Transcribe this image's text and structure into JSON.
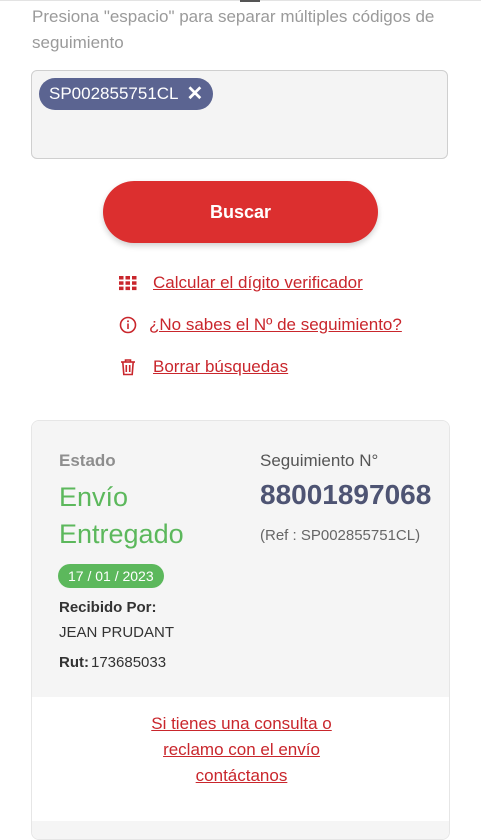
{
  "search": {
    "hint": "Presiona \"espacio\" para separar múltiples códigos de seguimiento",
    "chips": [
      {
        "code": "SP002855751CL"
      }
    ],
    "button_label": "Buscar"
  },
  "links": {
    "calc": "Calcular el dígito verificador",
    "unknown": "¿No sabes el Nº de seguimiento?",
    "clear": "Borrar búsquedas"
  },
  "result": {
    "estado_label": "Estado",
    "status": "Envío Entregado",
    "date": "17 / 01 / 2023",
    "recibido_label": "Recibido Por:",
    "recibido_value": "JEAN PRUDANT",
    "rut_label": "Rut:",
    "rut_value": "173685033",
    "seguimiento_label": "Seguimiento N°",
    "seguimiento_value": "88001897068",
    "ref": "(Ref : SP002855751CL)",
    "contact": [
      "Si tienes una consulta o",
      "reclamo con el envío",
      "contáctanos"
    ]
  },
  "colors": {
    "accent_red": "#dc2f2f",
    "link_red": "#c9262c",
    "chip_bg": "#5b6491",
    "status_green": "#5cb85c"
  },
  "icons": {
    "calc": "grid-icon",
    "unknown": "info-icon",
    "clear": "trash-icon",
    "chip_remove": "close-icon"
  }
}
